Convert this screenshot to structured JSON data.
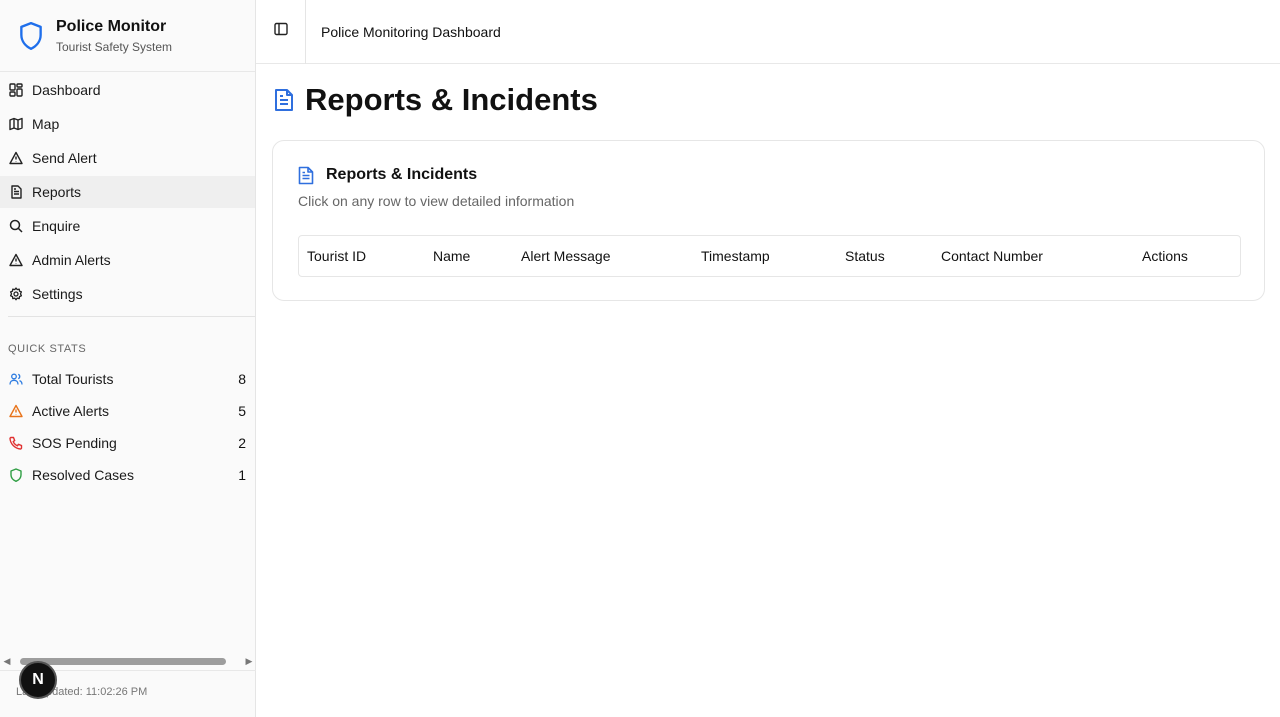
{
  "brand": {
    "title": "Police Monitor",
    "subtitle": "Tourist Safety System",
    "icon": "shield-icon",
    "accent": "#1f6feb"
  },
  "nav": [
    {
      "label": "Dashboard",
      "icon": "grid-icon",
      "active": false
    },
    {
      "label": "Map",
      "icon": "map-icon",
      "active": false
    },
    {
      "label": "Send Alert",
      "icon": "alert-triangle-icon",
      "active": false
    },
    {
      "label": "Reports",
      "icon": "file-text-icon",
      "active": true
    },
    {
      "label": "Enquire",
      "icon": "search-icon",
      "active": false
    },
    {
      "label": "Admin Alerts",
      "icon": "alert-triangle-icon",
      "active": false
    },
    {
      "label": "Settings",
      "icon": "gear-icon",
      "active": false
    }
  ],
  "quick_stats": {
    "label": "QUICK STATS",
    "items": [
      {
        "label": "Total Tourists",
        "value": "8",
        "icon": "users-icon",
        "color": "#2f7de1"
      },
      {
        "label": "Active Alerts",
        "value": "5",
        "icon": "alert-triangle-icon",
        "color": "#e8731a"
      },
      {
        "label": "SOS Pending",
        "value": "2",
        "icon": "phone-icon",
        "color": "#e03131"
      },
      {
        "label": "Resolved Cases",
        "value": "1",
        "icon": "shield-icon",
        "color": "#2f9e44"
      }
    ]
  },
  "footer": {
    "last_updated": "Last updated: 11:02:26 PM",
    "avatar_letter": "N"
  },
  "topbar": {
    "title": "Police Monitoring Dashboard",
    "toggle_icon": "sidebar-toggle-icon"
  },
  "page": {
    "title": "Reports & Incidents",
    "icon": "file-text-icon",
    "icon_color": "#2f6fde"
  },
  "card": {
    "title": "Reports & Incidents",
    "description": "Click on any row to view detailed information",
    "columns": [
      "Tourist ID",
      "Name",
      "Alert Message",
      "Timestamp",
      "Status",
      "Contact Number",
      "Actions"
    ]
  }
}
